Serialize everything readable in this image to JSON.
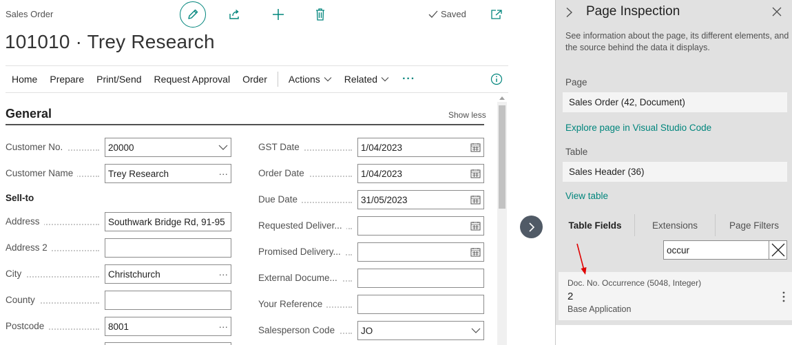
{
  "page": {
    "type_label": "Sales Order",
    "title": "101010 · Trey Research",
    "saved_label": "Saved"
  },
  "actionbar": {
    "items": [
      {
        "label": "Home"
      },
      {
        "label": "Prepare"
      },
      {
        "label": "Print/Send"
      },
      {
        "label": "Request Approval"
      },
      {
        "label": "Order"
      }
    ],
    "menus": [
      {
        "label": "Actions"
      },
      {
        "label": "Related"
      }
    ],
    "more_label": "···"
  },
  "section": {
    "title": "General",
    "show_less_label": "Show less",
    "sell_to_label": "Sell-to"
  },
  "left_fields": [
    {
      "label": "Customer No.",
      "value": "20000",
      "control": "dropdown"
    },
    {
      "label": "Customer Name",
      "value": "Trey Research",
      "control": "lookup"
    },
    {
      "label": "Address",
      "value": "Southwark Bridge Rd, 91-95",
      "control": "text"
    },
    {
      "label": "Address 2",
      "value": "",
      "control": "text"
    },
    {
      "label": "City",
      "value": "Christchurch",
      "control": "lookup"
    },
    {
      "label": "County",
      "value": "",
      "control": "text"
    },
    {
      "label": "Postcode",
      "value": "8001",
      "control": "lookup"
    }
  ],
  "right_fields": [
    {
      "label": "GST Date",
      "value": "1/04/2023",
      "control": "date"
    },
    {
      "label": "Order Date",
      "value": "1/04/2023",
      "control": "date"
    },
    {
      "label": "Due Date",
      "value": "31/05/2023",
      "control": "date"
    },
    {
      "label": "Requested Deliver...",
      "value": "",
      "control": "date"
    },
    {
      "label": "Promised Delivery...",
      "value": "",
      "control": "date"
    },
    {
      "label": "External Docume...",
      "value": "",
      "control": "text"
    },
    {
      "label": "Your Reference",
      "value": "",
      "control": "text"
    },
    {
      "label": "Salesperson Code",
      "value": "JO",
      "control": "dropdown"
    }
  ],
  "inspection": {
    "title": "Page Inspection",
    "description": "See information about the page, its different elements, and the source behind the data it displays.",
    "page_label": "Page",
    "page_value": "Sales Order (42, Document)",
    "explore_link": "Explore page in Visual Studio Code",
    "table_label": "Table",
    "table_value": "Sales Header (36)",
    "view_table_link": "View table",
    "tabs": [
      {
        "label": "Table Fields",
        "active": true
      },
      {
        "label": "Extensions",
        "active": false
      },
      {
        "label": "Page Filters",
        "active": false
      }
    ],
    "filter_value": "occur",
    "field_card": {
      "title": "Doc. No. Occurrence (5048, Integer)",
      "value": "2",
      "source": "Base Application"
    }
  },
  "colors": {
    "accent": "#00857c",
    "pane_background": "#e1e1e1",
    "annotation_arrow": "#e00000"
  }
}
